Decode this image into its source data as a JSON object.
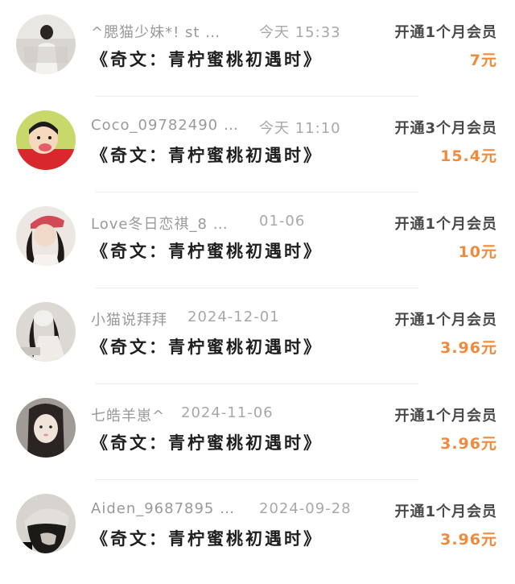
{
  "orders": [
    {
      "name": "^腮猫少妹*! st …",
      "time": "今天 15:33",
      "title": "《奇文：青柠蜜桃初遇时》",
      "plan": "开通1个月会员",
      "price": "7元"
    },
    {
      "name": "Coco_09782490 …",
      "time": "今天 11:10",
      "title": "《奇文：青柠蜜桃初遇时》",
      "plan": "开通3个月会员",
      "price": "15.4元"
    },
    {
      "name": "Love冬日恋祺_8 …",
      "time": "01-06",
      "title": "《奇文：青柠蜜桃初遇时》",
      "plan": "开通1个月会员",
      "price": "10元"
    },
    {
      "name": "小猫说拜拜",
      "time": "2024-12-01",
      "title": "《奇文：青柠蜜桃初遇时》",
      "plan": "开通1个月会员",
      "price": "3.96元"
    },
    {
      "name": "七皓羊崽^",
      "time": "2024-11-06",
      "title": "《奇文：青柠蜜桃初遇时》",
      "plan": "开通1个月会员",
      "price": "3.96元"
    },
    {
      "name": "Aiden_9687895 …",
      "time": "2024-09-28",
      "title": "《奇文：青柠蜜桃初遇时》",
      "plan": "开通1个月会员",
      "price": "3.96元"
    }
  ],
  "colors": {
    "price": "#f08a3c",
    "name": "#9a9a9a",
    "title": "#1f1f1f"
  }
}
